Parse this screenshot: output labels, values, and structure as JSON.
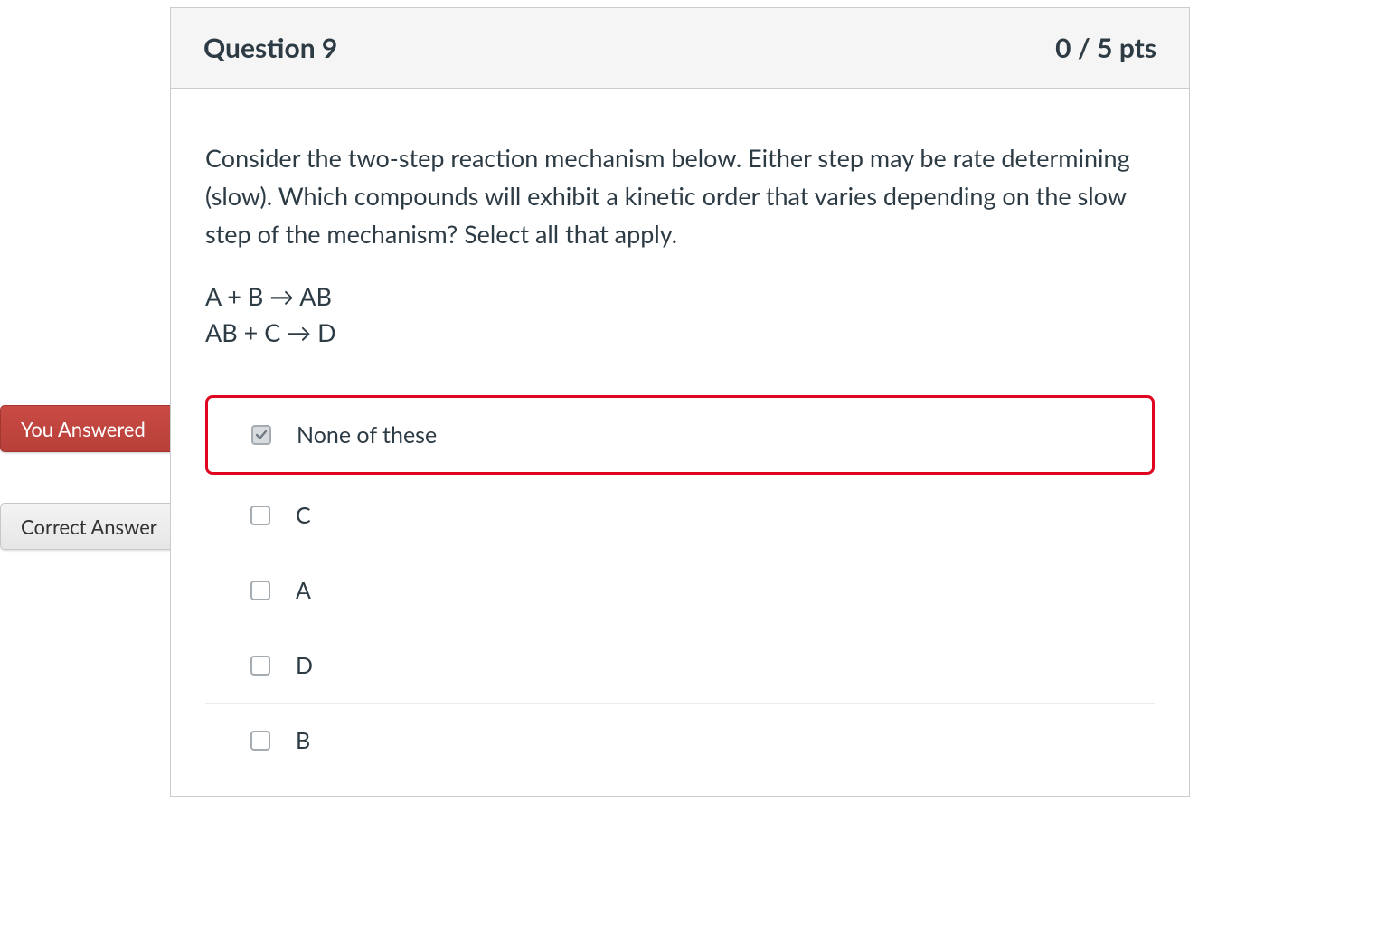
{
  "header": {
    "title": "Question 9",
    "points": "0 / 5 pts"
  },
  "question": {
    "prompt": "Consider the two-step reaction mechanism below. Either step may be rate determining (slow). Which compounds will exhibit a kinetic order that varies depending on the slow step of the mechanism? Select all that apply.",
    "step1": "A + B → AB",
    "step2": "AB + C → D"
  },
  "flags": {
    "you_answered": "You Answered",
    "correct_answer": "Correct Answer"
  },
  "answers": {
    "opt1": {
      "label": "None of these",
      "checked": true,
      "user_selected": true,
      "is_correct": false
    },
    "opt2": {
      "label": "C",
      "checked": false,
      "user_selected": false,
      "is_correct": true
    },
    "opt3": {
      "label": "A",
      "checked": false,
      "user_selected": false,
      "is_correct": false
    },
    "opt4": {
      "label": "D",
      "checked": false,
      "user_selected": false,
      "is_correct": false
    },
    "opt5": {
      "label": "B",
      "checked": false,
      "user_selected": false,
      "is_correct": false
    }
  }
}
